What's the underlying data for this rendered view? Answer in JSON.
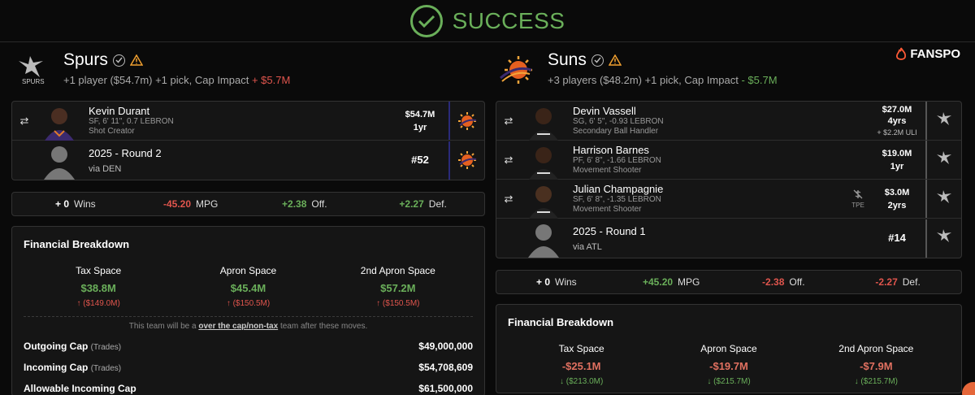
{
  "banner": {
    "title": "SUCCESS"
  },
  "brand": {
    "name": "FANSPO"
  },
  "colors": {
    "positive": "#6aaf5a",
    "negative": "#e0554d",
    "background": "#0a0a0a"
  },
  "left": {
    "team": "Spurs",
    "summary": "+1 player ($54.7m) +1 pick, Cap Impact",
    "cap_impact": "+ $5.7M",
    "assets": [
      {
        "type": "player",
        "name": "Kevin Durant",
        "line1": "SF, 6' 11\", 0.7 LEBRON",
        "line2": "Shot Creator",
        "salary": "$54.7M",
        "term": "1yr",
        "from_icon": "suns-icon"
      },
      {
        "type": "pick",
        "name": "2025 - Round 2",
        "via": "via DEN",
        "pick_no": "#52",
        "from_icon": "suns-icon"
      }
    ],
    "impact": {
      "wins": "+ 0",
      "wins_label": "Wins",
      "mpg": "-45.20",
      "mpg_label": "MPG",
      "off": "+2.38",
      "off_label": "Off.",
      "def": "+2.27",
      "def_label": "Def."
    },
    "financial": {
      "title": "Financial Breakdown",
      "cols": [
        {
          "label": "Tax Space",
          "value": "$38.8M",
          "delta": "($149.0M)"
        },
        {
          "label": "Apron Space",
          "value": "$45.4M",
          "delta": "($150.5M)"
        },
        {
          "label": "2nd Apron Space",
          "value": "$57.2M",
          "delta": "($150.5M)"
        }
      ],
      "note_pre": "This team will be a",
      "note_link": "over the cap/non-tax",
      "note_post": "team after these moves.",
      "rows": [
        {
          "label": "Outgoing Cap",
          "tag": "(Trades)",
          "amount": "$49,000,000"
        },
        {
          "label": "Incoming Cap",
          "tag": "(Trades)",
          "amount": "$54,708,609"
        },
        {
          "label": "Allowable Incoming Cap",
          "tag": "",
          "amount": "$61,500,000"
        }
      ]
    }
  },
  "right": {
    "team": "Suns",
    "summary": "+3 players ($48.2m) +1 pick, Cap Impact",
    "cap_impact": "- $5.7M",
    "assets": [
      {
        "type": "player",
        "name": "Devin Vassell",
        "line1": "SG, 6' 5\", -0.93 LEBRON",
        "line2": "Secondary Ball Handler",
        "salary": "$27.0M",
        "term": "4yrs",
        "extra": "+ $2.2M ULI",
        "from_icon": "spurs-icon"
      },
      {
        "type": "player",
        "name": "Harrison Barnes",
        "line1": "PF, 6' 8\", -1.66 LEBRON",
        "line2": "Movement Shooter",
        "salary": "$19.0M",
        "term": "1yr",
        "from_icon": "spurs-icon"
      },
      {
        "type": "player",
        "name": "Julian Champagnie",
        "line1": "SF, 6' 8\", -1.35 LEBRON",
        "line2": "Movement Shooter",
        "salary": "$3.0M",
        "term": "2yrs",
        "tpe": "TPE",
        "from_icon": "spurs-icon"
      },
      {
        "type": "pick",
        "name": "2025 - Round 1",
        "via": "via ATL",
        "pick_no": "#14",
        "from_icon": "spurs-icon"
      }
    ],
    "impact": {
      "wins": "+ 0",
      "wins_label": "Wins",
      "mpg": "+45.20",
      "mpg_label": "MPG",
      "off": "-2.38",
      "off_label": "Off.",
      "def": "-2.27",
      "def_label": "Def."
    },
    "financial": {
      "title": "Financial Breakdown",
      "cols": [
        {
          "label": "Tax Space",
          "value": "-$25.1M",
          "delta": "($213.0M)"
        },
        {
          "label": "Apron Space",
          "value": "-$19.7M",
          "delta": "($215.7M)"
        },
        {
          "label": "2nd Apron Space",
          "value": "-$7.9M",
          "delta": "($215.7M)"
        }
      ]
    }
  }
}
